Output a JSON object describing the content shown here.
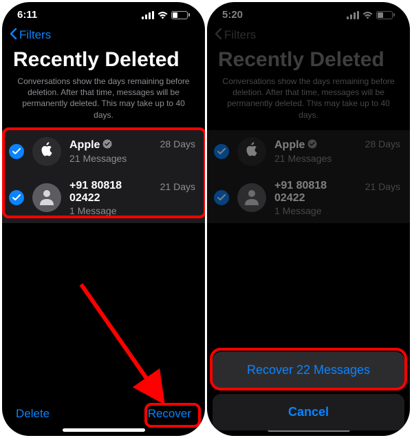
{
  "left": {
    "status": {
      "time": "6:11",
      "battery": "35"
    },
    "back": "Filters",
    "title": "Recently Deleted",
    "subtitle": "Conversations show the days remaining before deletion. After that time, messages will be permanently deleted. This may take up to 40 days.",
    "rows": [
      {
        "name": "Apple",
        "sub": "21 Messages",
        "days": "28 Days"
      },
      {
        "name": "+91 80818 02422",
        "sub": "1 Message",
        "days": "21 Days"
      }
    ],
    "delete": "Delete",
    "recover": "Recover"
  },
  "right": {
    "status": {
      "time": "5:20",
      "battery": "41"
    },
    "back": "Filters",
    "title": "Recently Deleted",
    "subtitle": "Conversations show the days remaining before deletion. After that time, messages will be permanently deleted. This may take up to 40 days.",
    "rows": [
      {
        "name": "Apple",
        "sub": "21 Messages",
        "days": "28 Days"
      },
      {
        "name": "+91 80818 02422",
        "sub": "1 Message",
        "days": "21 Days"
      }
    ],
    "sheet": {
      "recover": "Recover 22 Messages",
      "cancel": "Cancel"
    }
  }
}
